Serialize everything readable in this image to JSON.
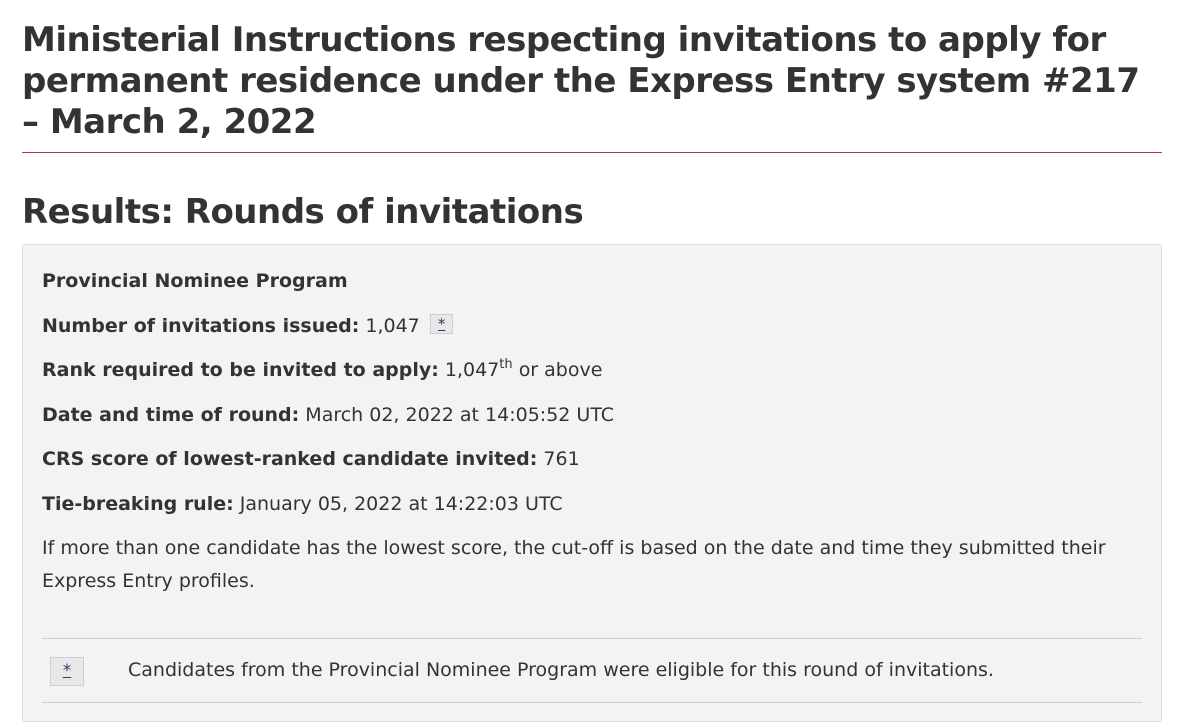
{
  "page": {
    "title": "Ministerial Instructions respecting invitations to apply for permanent residence under the Express Entry system #217 – March 2, 2022",
    "section_heading": "Results: Rounds of invitations"
  },
  "round": {
    "program": "Provincial Nominee Program",
    "invitations_label": "Number of invitations issued:",
    "invitations_value": "1,047",
    "footnote_marker": "*",
    "rank_label": "Rank required to be invited to apply:",
    "rank_value": "1,047",
    "rank_suffix": "th",
    "rank_tail": "or above",
    "datetime_label": "Date and time of round:",
    "datetime_value": "March 02, 2022 at 14:05:52 UTC",
    "crs_label": "CRS score of lowest-ranked candidate invited:",
    "crs_value": "761",
    "tie_label": "Tie-breaking rule:",
    "tie_value": "January 05, 2022 at 14:22:03 UTC",
    "tie_note": "If more than one candidate has the lowest score, the cut-off is based on the date and time they submitted their Express Entry profiles."
  },
  "footnote": {
    "marker": "*",
    "text": "Candidates from the Provincial Nominee Program were eligible for this round of invitations."
  },
  "colors": {
    "heading_rule": "#af3c43",
    "panel_background": "#f3f3f3",
    "link": "#284162"
  }
}
